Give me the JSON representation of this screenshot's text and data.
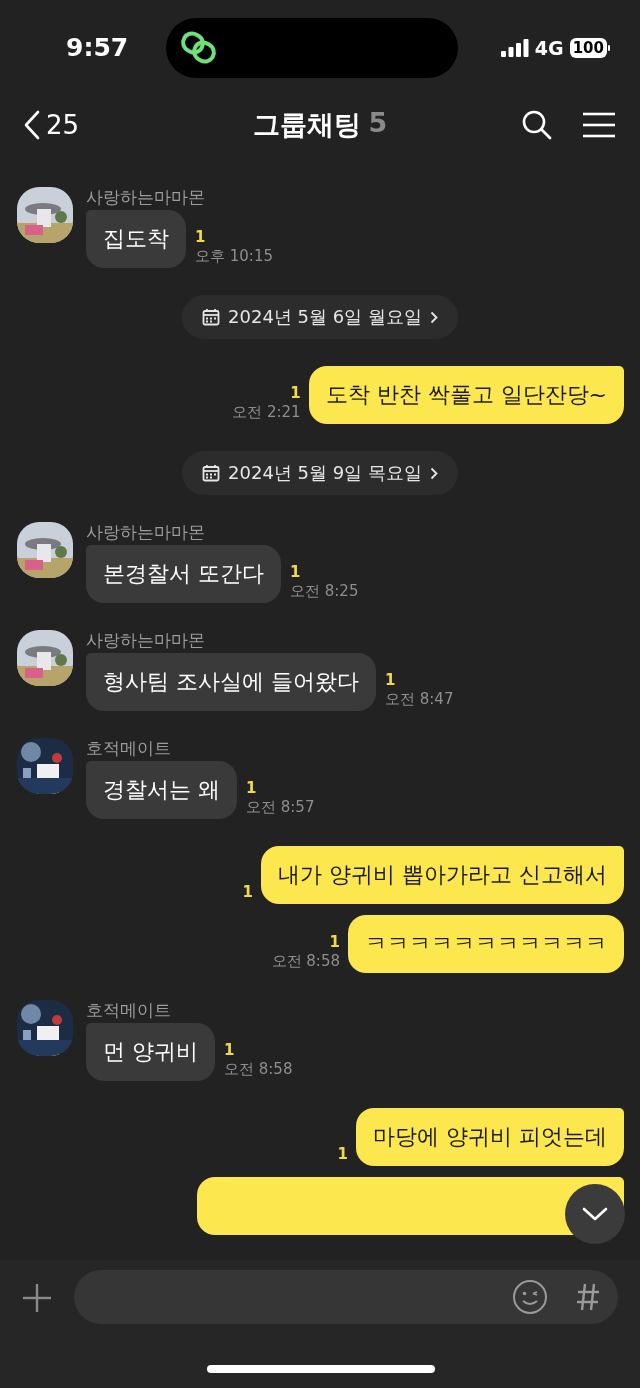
{
  "status_bar": {
    "time": "9:57",
    "network": "4G",
    "battery": "100"
  },
  "header": {
    "back_count": "25",
    "title": "그룹채팅",
    "member_count": "5"
  },
  "messages": [
    {
      "kind": "received",
      "sender": "사랑하는마마몬",
      "text": "집도착",
      "unread": "1",
      "time": "오후 10:15"
    },
    {
      "kind": "date",
      "text": "2024년 5월 6일 월요일"
    },
    {
      "kind": "sent",
      "tail": true,
      "text": "도착 반찬 싹풀고 일단잔당~",
      "unread": "1",
      "time": "오전 2:21"
    },
    {
      "kind": "date",
      "text": "2024년 5월 9일 목요일"
    },
    {
      "kind": "received",
      "sender": "사랑하는마마몬",
      "text": "본경찰서 또간다",
      "unread": "1",
      "time": "오전 8:25"
    },
    {
      "kind": "received",
      "sender": "사랑하는마마몬",
      "text": "형사팀 조사실에 들어왔다",
      "unread": "1",
      "time": "오전 8:47"
    },
    {
      "kind": "received",
      "sender": "호적메이트",
      "text": "경찰서는 왜",
      "unread": "1",
      "time": "오전 8:57"
    },
    {
      "kind": "sent",
      "tail": true,
      "text": "내가 양귀비 뽑아가라고 신고해서",
      "unread": "1"
    },
    {
      "kind": "sent",
      "tail": false,
      "text": "ㅋㅋㅋㅋㅋㅋㅋㅋㅋㅋㅋ",
      "unread": "1",
      "time": "오전 8:58"
    },
    {
      "kind": "received",
      "sender": "호적메이트",
      "text": "먼 양귀비",
      "unread": "1",
      "time": "오전 8:58"
    },
    {
      "kind": "sent",
      "tail": true,
      "text": "마당에 양귀비 피엇는데",
      "unread": "1"
    },
    {
      "kind": "sent_cut"
    }
  ]
}
